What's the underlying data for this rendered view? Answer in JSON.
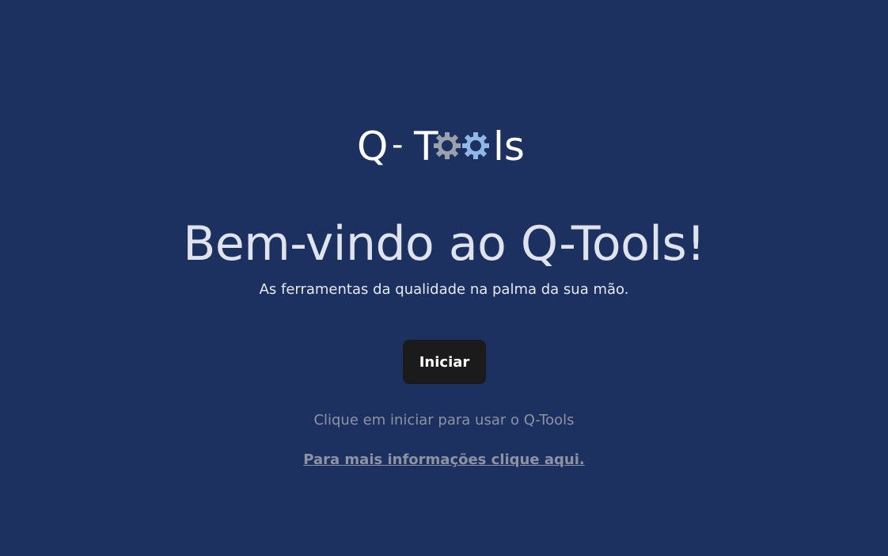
{
  "logo": {
    "text_q": "Q",
    "text_dash": "-",
    "text_t": "T",
    "text_ls": "ls",
    "gear_colors": [
      "#9aa1ad",
      "#8fb8e6"
    ],
    "text_color": "#ffffff"
  },
  "hero": {
    "title": "Bem-vindo ao Q-Tools!",
    "subtitle": "As ferramentas da qualidade na palma da sua mão."
  },
  "actions": {
    "start_label": "Iniciar",
    "hint": "Clique em iniciar para usar o Q-Tools",
    "more_info_link": "Para mais informações clique aqui."
  },
  "colors": {
    "background": "#1c3160",
    "button": "#1b1b1b",
    "muted_text": "#8d93a3"
  }
}
